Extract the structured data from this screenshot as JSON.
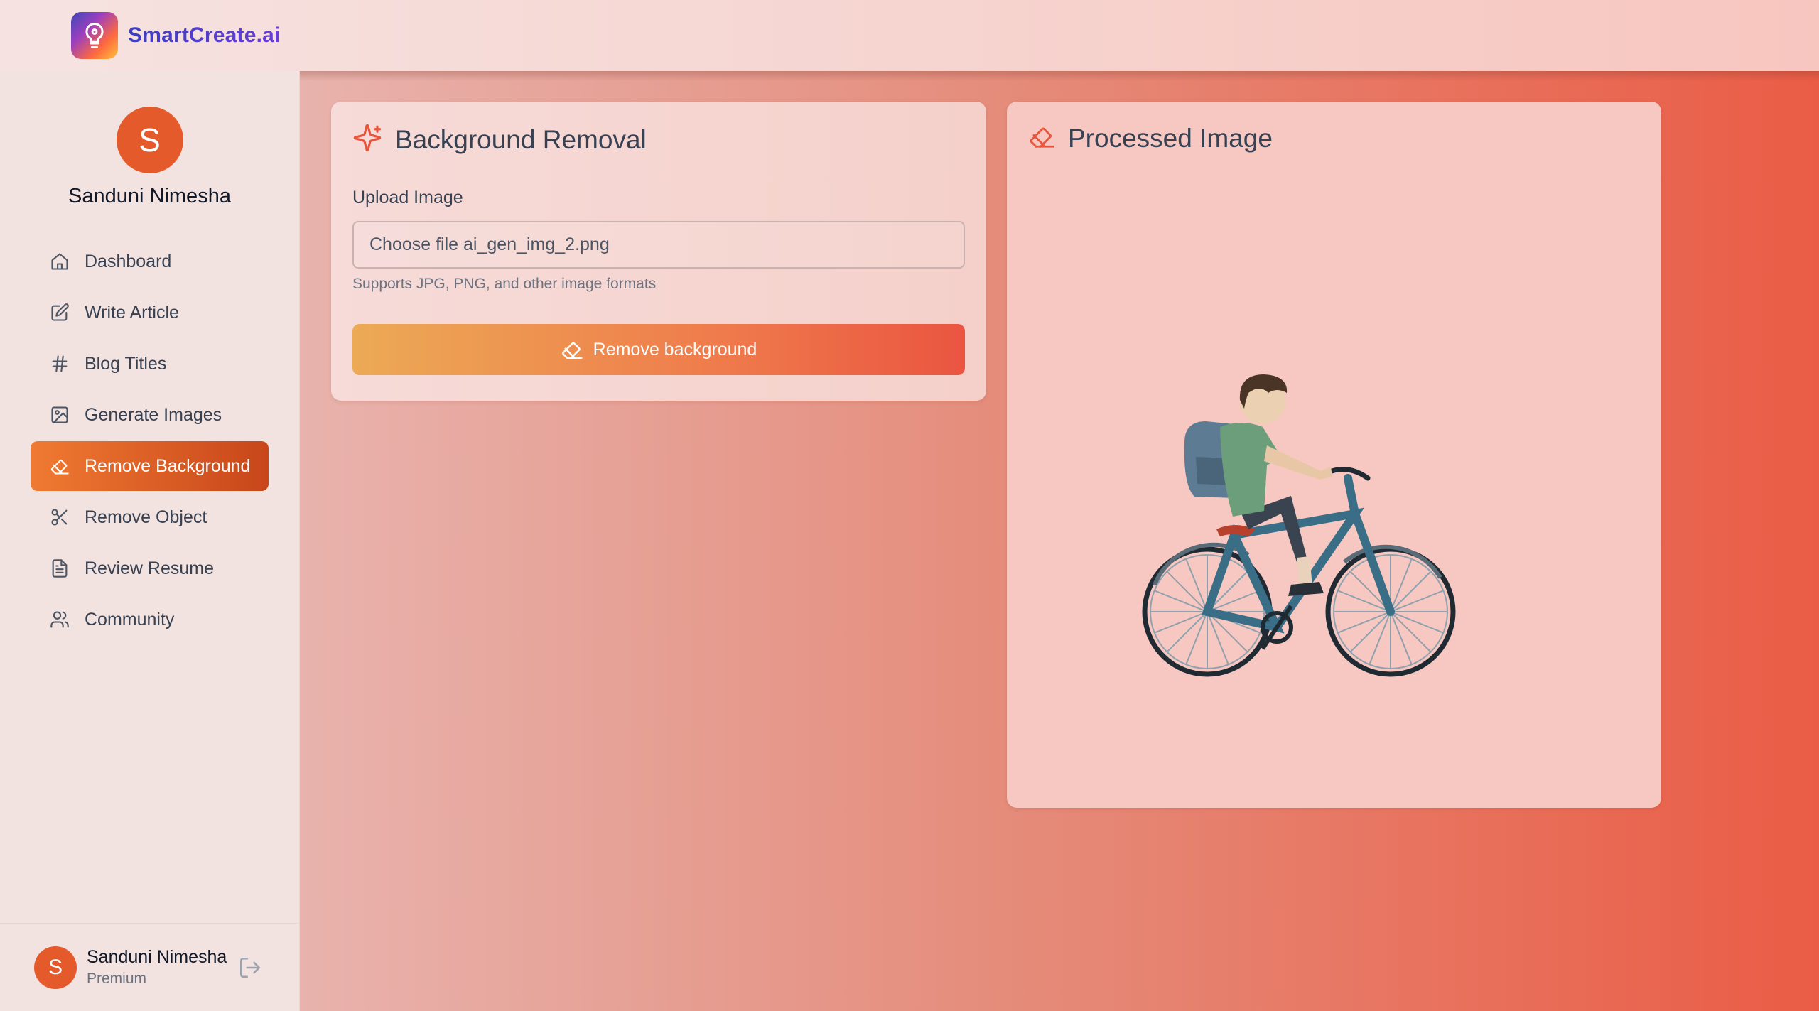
{
  "brand": {
    "name": "SmartCreate.ai"
  },
  "user": {
    "name": "Sanduni Nimesha",
    "initial": "S",
    "plan": "Premium"
  },
  "sidebar": {
    "items": [
      {
        "label": "Dashboard",
        "icon": "home-icon",
        "active": false
      },
      {
        "label": "Write Article",
        "icon": "edit-icon",
        "active": false
      },
      {
        "label": "Blog Titles",
        "icon": "hash-icon",
        "active": false
      },
      {
        "label": "Generate Images",
        "icon": "image-icon",
        "active": false
      },
      {
        "label": "Remove Background",
        "icon": "eraser-icon",
        "active": true
      },
      {
        "label": "Remove Object",
        "icon": "scissors-icon",
        "active": false
      },
      {
        "label": "Review Resume",
        "icon": "file-text-icon",
        "active": false
      },
      {
        "label": "Community",
        "icon": "users-icon",
        "active": false
      }
    ]
  },
  "upload_card": {
    "title": "Background Removal",
    "field_label": "Upload Image",
    "file_value": "Choose file ai_gen_img_2.png",
    "hint": "Supports JPG, PNG, and other image formats",
    "button_label": "Remove background"
  },
  "result_card": {
    "title": "Processed Image",
    "image": "boy-riding-bicycle-illustration"
  },
  "colors": {
    "accent": "#e55a2b",
    "active_nav_start": "#f07a32",
    "active_nav_end": "#c8461a",
    "button_start": "#ecaa55",
    "button_end": "#ea5541"
  }
}
